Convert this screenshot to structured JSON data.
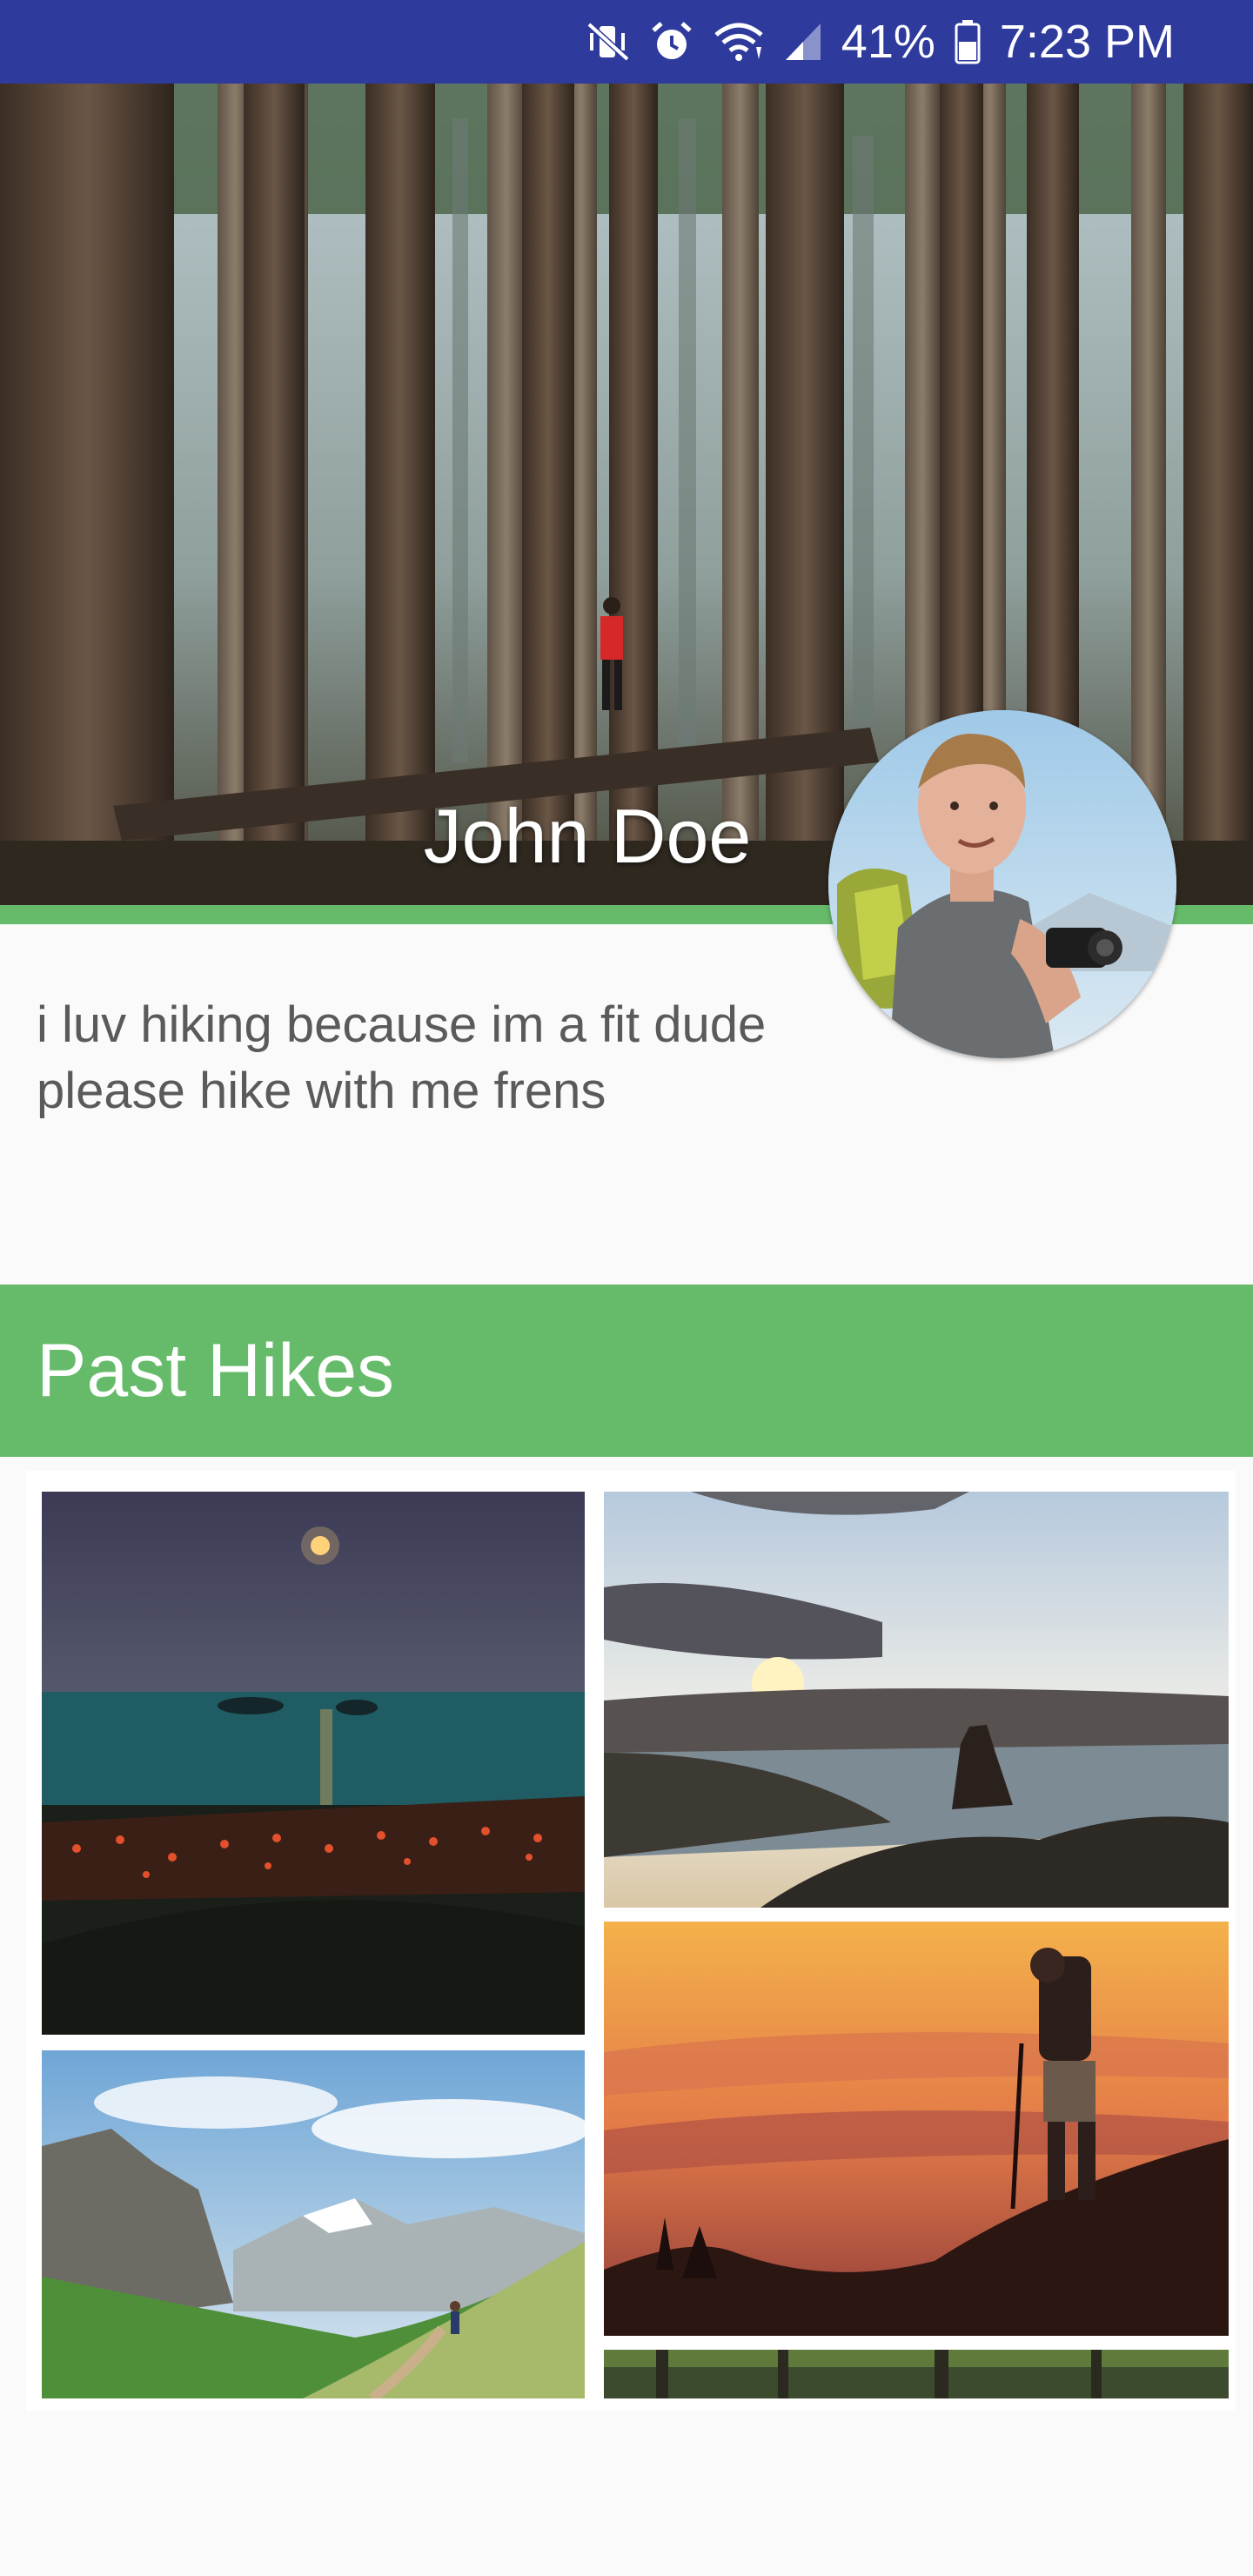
{
  "status_bar": {
    "icons": [
      "mute-vibrate-icon",
      "alarm-icon",
      "wifi-icon",
      "signal-icon",
      "battery-icon"
    ],
    "battery": "41%",
    "time": "7:23 PM",
    "background": "#2e3a9c"
  },
  "profile": {
    "name": "John Doe",
    "bio": "i luv hiking because im a fit dude please hike with me frens"
  },
  "past_hikes": {
    "title": "Past Hikes",
    "accent": "#66bb6a"
  }
}
